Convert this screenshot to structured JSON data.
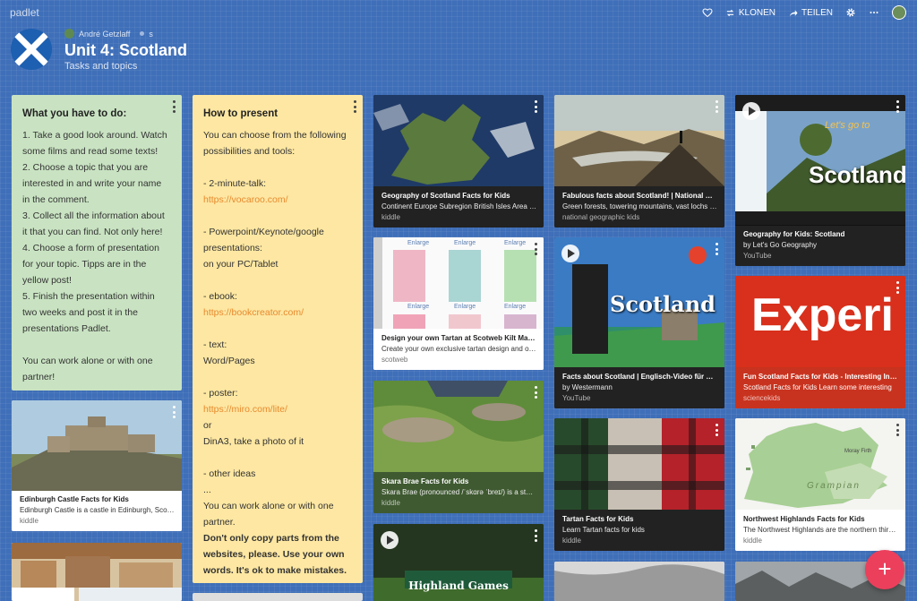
{
  "topbar": {
    "brand": "padlet",
    "clone_label": "KLONEN",
    "share_label": "TEILEN",
    "icons": [
      "heart-icon",
      "clone-icon",
      "share-icon",
      "gear-icon",
      "more-icon",
      "avatar"
    ]
  },
  "header": {
    "author": "André Getzlaff",
    "author_suffix": "s",
    "title": "Unit 4: Scotland",
    "subtitle": "Tasks and topics"
  },
  "col1": {
    "todo": {
      "title": "What you have to do:",
      "body": "1. Take a good look around. Watch some films and read some texts!\n2. Choose a topic that you are interested in and write your name in the comment.\n3. Collect all the information about it that you can find. Not only here!\n4. Choose a form of presentation for your topic. Tipps are in the yellow post!\n5. Finish the presentation within two weeks and post it in the presentations Padlet.\n\nYou can work alone or with one partner!"
    },
    "edinburgh": {
      "title": "Edinburgh Castle Facts for Kids",
      "desc": "Edinburgh Castle is a castle in Edinburgh, Scotland.",
      "source": "kiddle"
    }
  },
  "col2": {
    "present": {
      "title": "How to present",
      "intro": "You can choose from the following possibilities and tools:",
      "talk_label": "- 2-minute-talk:",
      "talk_link": "https://vocaroo.com/",
      "ppt_label": "- Powerpoint/Keynote/google presentations:",
      "ppt_device": "on your PC/Tablet",
      "ebook_label": "- ebook:",
      "ebook_link": "https://bookcreator.com/",
      "text_label": "- text:",
      "text_tools": "Word/Pages",
      "poster_label": "- poster:",
      "poster_link": "https://miro.com/lite/",
      "or": "or",
      "dina3": "DinA3, take a photo of it",
      "other": "- other ideas",
      "ellipsis": "...",
      "alone": "You can work alone or with one partner.",
      "warning": "Don't only copy parts from the websites, please. Use your own words. It's ok to make mistakes."
    }
  },
  "col3": {
    "geography": {
      "title": "Geography of Scotland Facts for Kids",
      "desc": "Continent Europe Subregion British Isles Area Ranked",
      "source": "kiddle"
    },
    "tartan_design": {
      "title": "Design your own Tartan at Scotweb Kilt Makers",
      "desc": "Create your own exclusive tartan design and order it",
      "source": "scotweb",
      "enlarge": "Enlarge"
    },
    "skara": {
      "title": "Skara Brae Facts for Kids",
      "desc": "Skara Brae (pronounced /ˈskɑrə ˈbreɪ/) is a stone-built",
      "source": "kiddle"
    },
    "highland": {
      "overlay": "Highland Games"
    }
  },
  "col4": {
    "fabulous": {
      "title": "Fabulous facts about Scotland! | National Geographic Kids",
      "desc": "Green forests, towering mountains, vast lochs and",
      "source": "national geographic kids"
    },
    "facts_video": {
      "overlay": "Scotland",
      "title": "Facts about Scotland | Englisch-Video für die Schule",
      "author": "by Westermann",
      "source": "YouTube"
    },
    "tartan": {
      "title": "Tartan Facts for Kids",
      "desc": "Learn Tartan facts for kids",
      "source": "kiddle"
    }
  },
  "col5": {
    "geo_video": {
      "overlay": "Scotland",
      "overlay_small": "Let's go to",
      "title": "Geography for Kids: Scotland",
      "author": "by Let's Go Geography",
      "source": "YouTube"
    },
    "science": {
      "overlay": "Experi",
      "title": "Fun Scotland Facts for Kids - Interesting Information",
      "desc": "Scotland Facts for Kids Learn some interesting",
      "source": "sciencekids"
    },
    "highlands": {
      "title": "Northwest Highlands Facts for Kids",
      "desc": "The Northwest Highlands are the northern third of",
      "source": "kiddle",
      "map_text_1": "Moray Firth",
      "map_text_2": "Grampian"
    }
  },
  "fab": {
    "label": "+"
  },
  "colors": {
    "background": "#3f6fb8",
    "green_post": "#c9e3c2",
    "yellow_post": "#fde7a2",
    "link": "#e88a2e",
    "fab": "#ec3f5c",
    "red_card": "#c8331f"
  }
}
